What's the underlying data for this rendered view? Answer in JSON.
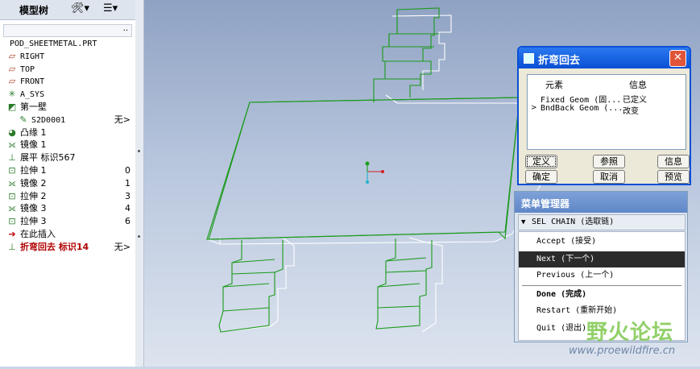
{
  "model_tree": {
    "title": "模型树",
    "settings_icon": "tools-icon",
    "columns_icon": "list-icon",
    "dots": "..",
    "items": [
      {
        "icon": "part-icon",
        "glyph": "",
        "label": "POD_SHEETMETAL.PRT",
        "mono": true,
        "suffix": ""
      },
      {
        "icon": "datum-plane-icon",
        "glyph": "▱",
        "label": "RIGHT",
        "mono": true,
        "suffix": ""
      },
      {
        "icon": "datum-plane-icon",
        "glyph": "▱",
        "label": "TOP",
        "mono": true,
        "suffix": ""
      },
      {
        "icon": "datum-plane-icon",
        "glyph": "▱",
        "label": "FRONT",
        "mono": true,
        "suffix": ""
      },
      {
        "icon": "coordinate-system-icon",
        "glyph": "✳",
        "label": "A_SYS",
        "mono": true,
        "suffix": ""
      },
      {
        "icon": "first-wall-icon",
        "glyph": "◩",
        "label": "第一壁",
        "mono": false,
        "suffix": ""
      },
      {
        "icon": "sketch-icon",
        "glyph": "✎",
        "label": "S2D0001",
        "mono": true,
        "suffix": "无>"
      },
      {
        "icon": "flange-icon",
        "glyph": "◕",
        "label": "凸缘 1",
        "mono": false,
        "suffix": ""
      },
      {
        "icon": "mirror-icon",
        "glyph": "⟗",
        "label": "镜像 1",
        "mono": false,
        "suffix": ""
      },
      {
        "icon": "unbend-icon",
        "glyph": "⊥",
        "label": "展平 标识567",
        "mono": false,
        "suffix": ""
      },
      {
        "icon": "extrude-icon",
        "glyph": "⊡",
        "label": "拉伸 1",
        "mono": false,
        "suffix": "0"
      },
      {
        "icon": "mirror-icon",
        "glyph": "⟗",
        "label": "镜像 2",
        "mono": false,
        "suffix": "1"
      },
      {
        "icon": "extrude-icon",
        "glyph": "⊡",
        "label": "拉伸 2",
        "mono": false,
        "suffix": "3"
      },
      {
        "icon": "mirror-icon",
        "glyph": "⟗",
        "label": "镜像 3",
        "mono": false,
        "suffix": "4"
      },
      {
        "icon": "extrude-icon",
        "glyph": "⊡",
        "label": "拉伸 3",
        "mono": false,
        "suffix": "6"
      },
      {
        "icon": "insert-here-icon",
        "glyph": "➔",
        "label": "在此插入",
        "mono": false,
        "suffix": ""
      },
      {
        "icon": "bend-back-icon",
        "glyph": "⊥",
        "label": "折弯回去 标识14",
        "mono": false,
        "suffix": "无>",
        "active": true
      }
    ]
  },
  "dialog": {
    "title": "折弯回去",
    "col_element": "元素",
    "col_info": "信息",
    "rows": [
      {
        "element": "Fixed Geom (固...",
        "info": "已定义",
        "caret": ""
      },
      {
        "element": "BndBack Geom (...",
        "info": "改变",
        "caret": ">"
      }
    ],
    "buttons": {
      "define": "定义",
      "refs": "参照",
      "info": "信息",
      "ok": "确定",
      "cancel": "取消",
      "preview": "预览"
    }
  },
  "menu_manager": {
    "title": "菜单管理器",
    "submenu": "SEL CHAIN (选取链)",
    "items": [
      {
        "label": "Accept (接受)"
      },
      {
        "label": "Next (下一个)",
        "selected": true
      },
      {
        "label": "Previous (上一个)"
      },
      {
        "label": "Done (完成)",
        "bold": true
      },
      {
        "label": "Restart (重新开始)"
      },
      {
        "label": "Quit (退出)"
      }
    ]
  },
  "watermark": {
    "cn": "野火论坛",
    "url": "www.proewildfire.cn"
  },
  "colors": {
    "model_edges": "#1a9a1a",
    "model_edges_secondary": "#ffffff",
    "accent": "#0a4fd4"
  }
}
